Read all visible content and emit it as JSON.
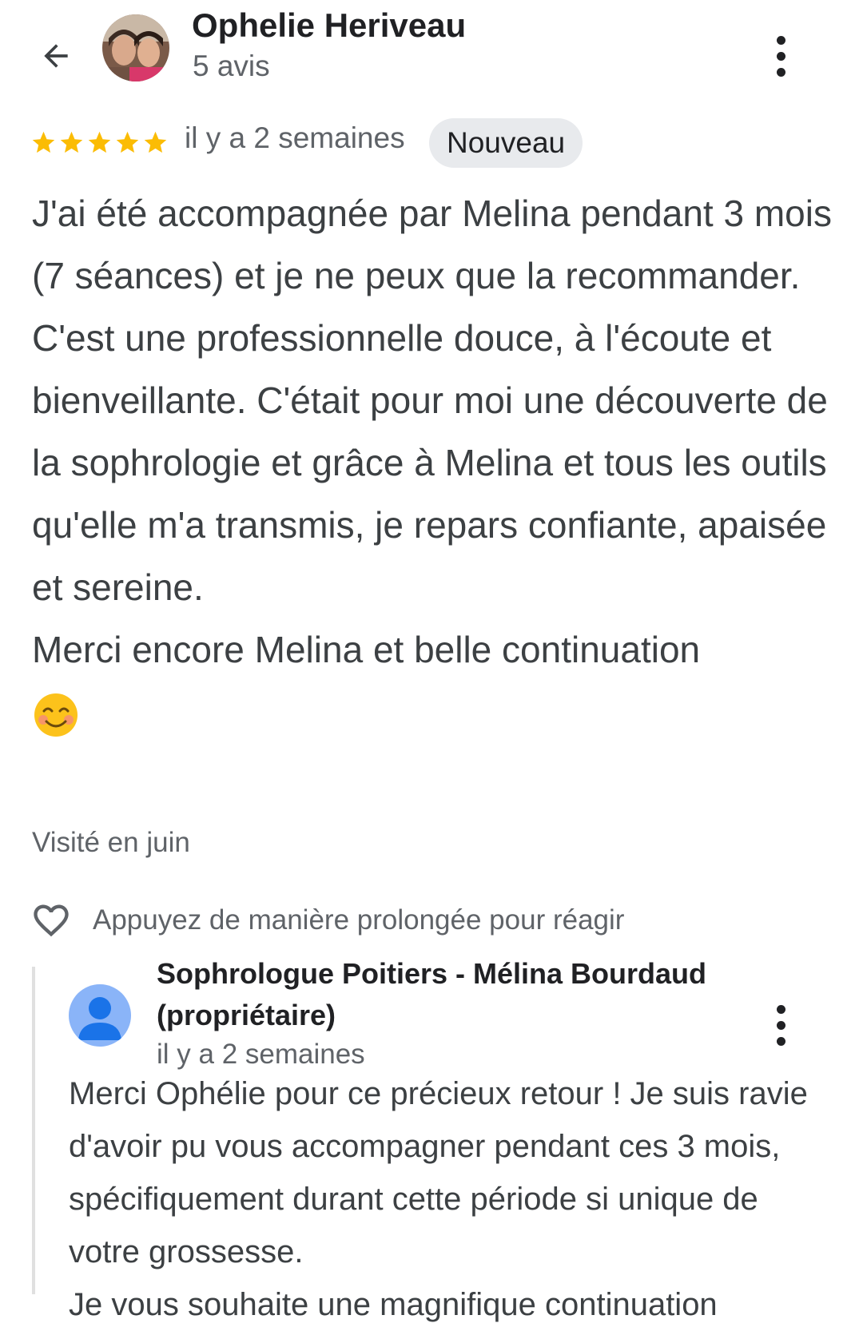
{
  "header": {
    "back_icon": "arrow-back-icon",
    "reviewer_name": "Ophelie Heriveau",
    "review_count": "5 avis",
    "menu_icon": "more-vert-icon"
  },
  "review": {
    "rating": 5,
    "rating_max": 5,
    "star_color": "#fbbc04",
    "date": "il y a 2 semaines",
    "badge": "Nouveau",
    "text_main": "J'ai été accompagnée par Melina pendant 3 mois (7 séances) et je ne peux que la recommander. C'est une professionnelle douce, à l'écoute et bienveillante. C'était pour moi une découverte de la sophrologie et grâce à Melina et tous les outils qu'elle m'a transmis, je repars confiante, apaisée et sereine.",
    "text_thanks": "Merci encore Melina et belle continuation",
    "emoji_icon": "smiling-face-emoji",
    "visited": "Visité en juin"
  },
  "reaction": {
    "icon": "heart-outline-icon",
    "label": "Appuyez de manière prolongée pour réagir"
  },
  "owner_reply": {
    "avatar_icon": "person-avatar-icon",
    "name_line1": "Sophrologue Poitiers - Mélina Bourdaud",
    "name_line2": "(propriétaire)",
    "date": "il y a 2 semaines",
    "menu_icon": "more-vert-icon",
    "text": "Merci Ophélie pour ce précieux retour ! Je suis ravie d'avoir pu vous accompagner pendant ces 3 mois, spécifiquement durant cette période si unique de votre grossesse.",
    "text_cut": "Je vous souhaite une magnifique continuation"
  }
}
